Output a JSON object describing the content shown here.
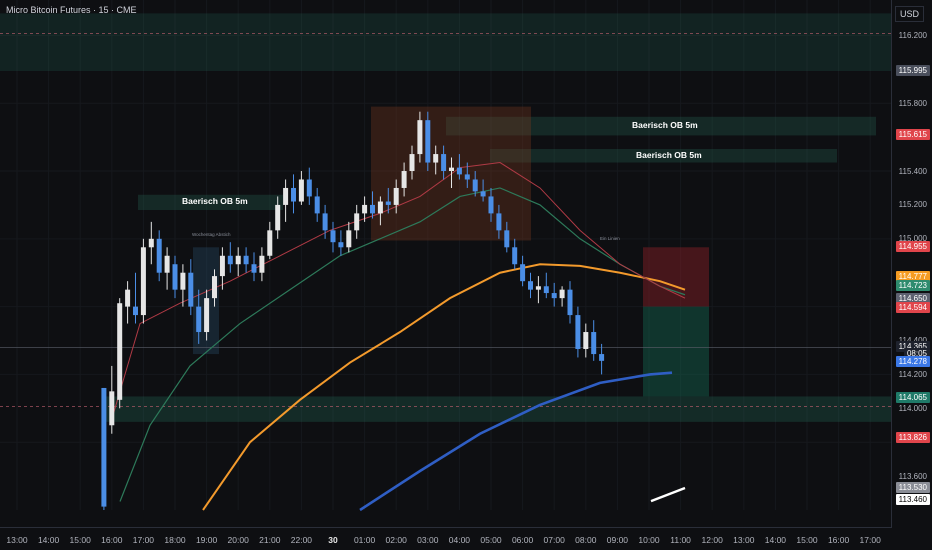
{
  "header": {
    "title": "Micro Bitcoin Futures · 15 · CME"
  },
  "price_axis": {
    "currency": "USD",
    "labels": [
      "116.200",
      "115.800",
      "115.400",
      "115.200",
      "115.000",
      "114.400",
      "114.200",
      "114.000",
      "113.600"
    ],
    "tags": [
      {
        "text": "115.995",
        "price": 115.995,
        "color": "#4a4f5c"
      },
      {
        "text": "115.615",
        "price": 115.615,
        "color": "#e0454b"
      },
      {
        "text": "114.955",
        "price": 114.955,
        "color": "#e0454b"
      },
      {
        "text": "114.777",
        "price": 114.777,
        "color": "#f59c23"
      },
      {
        "text": "114.723",
        "price": 114.723,
        "color": "#2e8b6e"
      },
      {
        "text": "114.650",
        "price": 114.65,
        "color": "#5d6170"
      },
      {
        "text": "114.594",
        "price": 114.594,
        "color": "#e0454b"
      },
      {
        "text": "114.365",
        "price": 114.365,
        "color": "#1e222d"
      },
      {
        "text": "08:05",
        "price": 114.325,
        "color": "#1e222d"
      },
      {
        "text": "114.278",
        "price": 114.278,
        "color": "#3b78e7"
      },
      {
        "text": "114.065",
        "price": 114.065,
        "color": "#1f7a68"
      },
      {
        "text": "113.826",
        "price": 113.826,
        "color": "#e0454b"
      },
      {
        "text": "113.530",
        "price": 113.53,
        "color": "#8a8d96"
      },
      {
        "text": "113.460",
        "price": 113.46,
        "color": "#ffffff"
      }
    ]
  },
  "time_axis": {
    "ticks": [
      "13:00",
      "14:00",
      "15:00",
      "16:00",
      "17:00",
      "18:00",
      "19:00",
      "20:00",
      "21:00",
      "22:00",
      "30",
      "01:00",
      "02:00",
      "03:00",
      "04:00",
      "05:00",
      "06:00",
      "07:00",
      "08:00",
      "09:00",
      "10:00",
      "11:00",
      "12:00",
      "13:00",
      "14:00",
      "15:00",
      "16:00",
      "17:00"
    ]
  },
  "annotations": {
    "ob_labels": [
      "Baerisch OB 5m",
      "Baerisch OB 5m",
      "Baerisch OB 5m"
    ],
    "tiny_labels": [
      "Wochentag Abstich",
      "Ein Linien"
    ]
  },
  "chart_data": {
    "type": "candlestick",
    "title": "Micro Bitcoin Futures · 15 · CME",
    "ylim": [
      113.4,
      116.35
    ],
    "y_axis": "right",
    "candles": [
      {
        "t": "15:45",
        "o": 114.12,
        "h": 114.12,
        "l": 113.4,
        "c": 113.42
      },
      {
        "t": "16:00",
        "o": 113.9,
        "h": 114.25,
        "l": 113.85,
        "c": 114.1
      },
      {
        "t": "16:15",
        "o": 114.05,
        "h": 114.65,
        "l": 114.0,
        "c": 114.62
      },
      {
        "t": "16:30",
        "o": 114.6,
        "h": 114.75,
        "l": 114.5,
        "c": 114.7
      },
      {
        "t": "16:45",
        "o": 114.6,
        "h": 114.8,
        "l": 114.5,
        "c": 114.55
      },
      {
        "t": "17:00",
        "o": 114.55,
        "h": 115.0,
        "l": 114.5,
        "c": 114.95
      },
      {
        "t": "17:15",
        "o": 114.95,
        "h": 115.1,
        "l": 114.85,
        "c": 115.0
      },
      {
        "t": "17:30",
        "o": 115.0,
        "h": 115.05,
        "l": 114.75,
        "c": 114.8
      },
      {
        "t": "17:45",
        "o": 114.8,
        "h": 114.95,
        "l": 114.7,
        "c": 114.9
      },
      {
        "t": "18:00",
        "o": 114.85,
        "h": 114.9,
        "l": 114.65,
        "c": 114.7
      },
      {
        "t": "18:15",
        "o": 114.7,
        "h": 114.85,
        "l": 114.6,
        "c": 114.8
      },
      {
        "t": "18:30",
        "o": 114.8,
        "h": 114.88,
        "l": 114.55,
        "c": 114.6
      },
      {
        "t": "18:45",
        "o": 114.6,
        "h": 114.7,
        "l": 114.38,
        "c": 114.45
      },
      {
        "t": "19:00",
        "o": 114.45,
        "h": 114.7,
        "l": 114.4,
        "c": 114.65
      },
      {
        "t": "19:15",
        "o": 114.65,
        "h": 114.82,
        "l": 114.6,
        "c": 114.78
      },
      {
        "t": "19:30",
        "o": 114.78,
        "h": 114.95,
        "l": 114.7,
        "c": 114.9
      },
      {
        "t": "19:45",
        "o": 114.9,
        "h": 114.98,
        "l": 114.8,
        "c": 114.85
      },
      {
        "t": "20:00",
        "o": 114.85,
        "h": 114.95,
        "l": 114.78,
        "c": 114.9
      },
      {
        "t": "20:15",
        "o": 114.9,
        "h": 114.95,
        "l": 114.8,
        "c": 114.85
      },
      {
        "t": "20:30",
        "o": 114.85,
        "h": 114.92,
        "l": 114.75,
        "c": 114.8
      },
      {
        "t": "20:45",
        "o": 114.8,
        "h": 114.95,
        "l": 114.75,
        "c": 114.9
      },
      {
        "t": "21:00",
        "o": 114.9,
        "h": 115.1,
        "l": 114.88,
        "c": 115.05
      },
      {
        "t": "21:15",
        "o": 115.05,
        "h": 115.25,
        "l": 115.0,
        "c": 115.2
      },
      {
        "t": "21:30",
        "o": 115.2,
        "h": 115.35,
        "l": 115.1,
        "c": 115.3
      },
      {
        "t": "21:45",
        "o": 115.3,
        "h": 115.38,
        "l": 115.15,
        "c": 115.22
      },
      {
        "t": "22:00",
        "o": 115.22,
        "h": 115.4,
        "l": 115.2,
        "c": 115.35
      },
      {
        "t": "22:15",
        "o": 115.35,
        "h": 115.42,
        "l": 115.2,
        "c": 115.25
      },
      {
        "t": "22:30",
        "o": 115.25,
        "h": 115.3,
        "l": 115.1,
        "c": 115.15
      },
      {
        "t": "22:45",
        "o": 115.15,
        "h": 115.2,
        "l": 115.0,
        "c": 115.05
      },
      {
        "t": "23:00",
        "o": 115.05,
        "h": 115.1,
        "l": 114.92,
        "c": 114.98
      },
      {
        "t": "23:15",
        "o": 114.98,
        "h": 115.05,
        "l": 114.9,
        "c": 114.95
      },
      {
        "t": "23:30",
        "o": 114.95,
        "h": 115.1,
        "l": 114.92,
        "c": 115.05
      },
      {
        "t": "23:45",
        "o": 115.05,
        "h": 115.2,
        "l": 115.0,
        "c": 115.15
      },
      {
        "t": "00:00",
        "o": 115.15,
        "h": 115.25,
        "l": 115.1,
        "c": 115.2
      },
      {
        "t": "00:15",
        "o": 115.2,
        "h": 115.28,
        "l": 115.12,
        "c": 115.15
      },
      {
        "t": "00:30",
        "o": 115.15,
        "h": 115.25,
        "l": 115.08,
        "c": 115.22
      },
      {
        "t": "00:45",
        "o": 115.22,
        "h": 115.3,
        "l": 115.15,
        "c": 115.2
      },
      {
        "t": "01:00",
        "o": 115.2,
        "h": 115.35,
        "l": 115.15,
        "c": 115.3
      },
      {
        "t": "01:15",
        "o": 115.3,
        "h": 115.45,
        "l": 115.25,
        "c": 115.4
      },
      {
        "t": "01:30",
        "o": 115.4,
        "h": 115.55,
        "l": 115.35,
        "c": 115.5
      },
      {
        "t": "01:45",
        "o": 115.5,
        "h": 115.75,
        "l": 115.45,
        "c": 115.7
      },
      {
        "t": "02:00",
        "o": 115.7,
        "h": 115.75,
        "l": 115.4,
        "c": 115.45
      },
      {
        "t": "02:15",
        "o": 115.45,
        "h": 115.55,
        "l": 115.38,
        "c": 115.5
      },
      {
        "t": "02:30",
        "o": 115.5,
        "h": 115.55,
        "l": 115.35,
        "c": 115.4
      },
      {
        "t": "02:45",
        "o": 115.4,
        "h": 115.48,
        "l": 115.3,
        "c": 115.42
      },
      {
        "t": "03:00",
        "o": 115.42,
        "h": 115.5,
        "l": 115.35,
        "c": 115.38
      },
      {
        "t": "03:15",
        "o": 115.38,
        "h": 115.45,
        "l": 115.3,
        "c": 115.35
      },
      {
        "t": "03:30",
        "o": 115.35,
        "h": 115.4,
        "l": 115.25,
        "c": 115.28
      },
      {
        "t": "03:45",
        "o": 115.28,
        "h": 115.35,
        "l": 115.22,
        "c": 115.25
      },
      {
        "t": "04:00",
        "o": 115.25,
        "h": 115.3,
        "l": 115.1,
        "c": 115.15
      },
      {
        "t": "04:15",
        "o": 115.15,
        "h": 115.2,
        "l": 115.0,
        "c": 115.05
      },
      {
        "t": "04:30",
        "o": 115.05,
        "h": 115.1,
        "l": 114.92,
        "c": 114.95
      },
      {
        "t": "04:45",
        "o": 114.95,
        "h": 115.0,
        "l": 114.82,
        "c": 114.85
      },
      {
        "t": "05:00",
        "o": 114.85,
        "h": 114.9,
        "l": 114.72,
        "c": 114.75
      },
      {
        "t": "05:15",
        "o": 114.75,
        "h": 114.8,
        "l": 114.65,
        "c": 114.7
      },
      {
        "t": "05:30",
        "o": 114.7,
        "h": 114.78,
        "l": 114.62,
        "c": 114.72
      },
      {
        "t": "05:45",
        "o": 114.72,
        "h": 114.8,
        "l": 114.65,
        "c": 114.68
      },
      {
        "t": "06:00",
        "o": 114.68,
        "h": 114.74,
        "l": 114.6,
        "c": 114.65
      },
      {
        "t": "06:15",
        "o": 114.65,
        "h": 114.72,
        "l": 114.6,
        "c": 114.7
      },
      {
        "t": "06:30",
        "o": 114.7,
        "h": 114.75,
        "l": 114.5,
        "c": 114.55
      },
      {
        "t": "06:45",
        "o": 114.55,
        "h": 114.6,
        "l": 114.3,
        "c": 114.35
      },
      {
        "t": "07:00",
        "o": 114.35,
        "h": 114.5,
        "l": 114.3,
        "c": 114.45
      },
      {
        "t": "07:15",
        "o": 114.45,
        "h": 114.52,
        "l": 114.28,
        "c": 114.32
      },
      {
        "t": "07:30",
        "o": 114.32,
        "h": 114.38,
        "l": 114.2,
        "c": 114.28
      }
    ]
  }
}
